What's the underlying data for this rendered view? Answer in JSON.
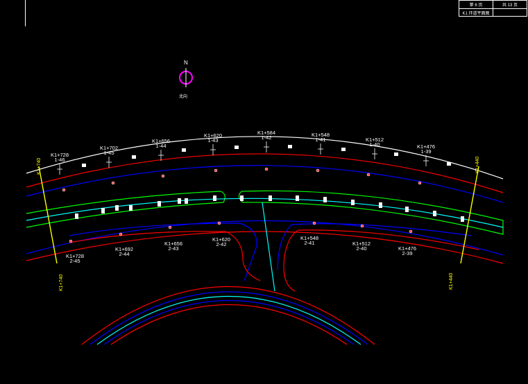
{
  "title_block": {
    "sheet_no": "第 6 页",
    "total": "共 13 页",
    "drawing_title": "K1 环道平面图"
  },
  "north_arrow": {
    "label": "N",
    "caption": "北向"
  },
  "top_stations": [
    {
      "station": "K1+728",
      "sub": "1-46"
    },
    {
      "station": "K1+702",
      "sub": "1-45"
    },
    {
      "station": "K1+656",
      "sub": "1-44"
    },
    {
      "station": "K1+620",
      "sub": "1-43"
    },
    {
      "station": "K1+584",
      "sub": "1-42"
    },
    {
      "station": "K1+548",
      "sub": "1-41"
    },
    {
      "station": "K1+512",
      "sub": "1-40"
    },
    {
      "station": "K1+476",
      "sub": "1-39"
    }
  ],
  "bottom_stations": [
    {
      "station": "K1+728",
      "sub": "2-45"
    },
    {
      "station": "K1+692",
      "sub": "2-44"
    },
    {
      "station": "K1+656",
      "sub": "2-43"
    },
    {
      "station": "K1+620",
      "sub": "2-42"
    },
    {
      "station": "K1+548",
      "sub": "2-41"
    },
    {
      "station": "K1+512",
      "sub": "2-40"
    },
    {
      "station": "K1+476",
      "sub": "2-39"
    }
  ],
  "boundary_labels": {
    "left_top": "K1+740",
    "right_top": "K1+440",
    "left_bottom": "K1+740",
    "right_bottom": "K1+440"
  },
  "colors": {
    "background": "#000000",
    "edge": "#ff0000",
    "inner": "#0000ff",
    "median": "#00ff00",
    "centerline": "#00ffff",
    "outer": "#ffffff",
    "boundary": "#ffff00",
    "north": "#ff00ff"
  }
}
